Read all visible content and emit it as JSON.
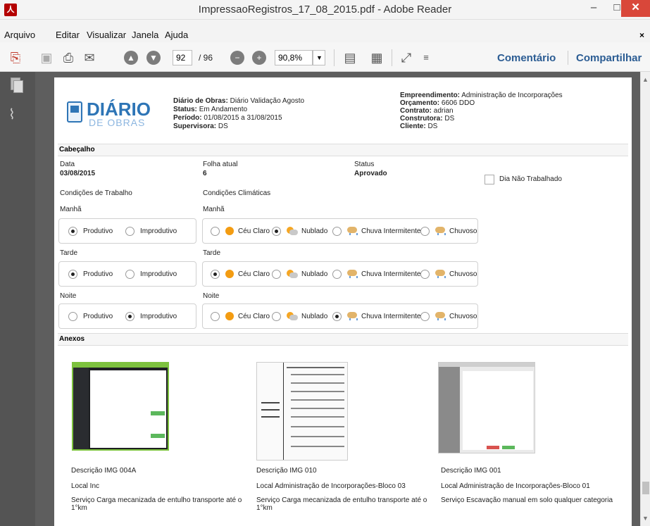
{
  "window": {
    "title": "ImpressaoRegistros_17_08_2015.pdf - Adobe Reader",
    "minimize": "–",
    "maximize": "□",
    "close": "✕"
  },
  "menu": [
    "Arquivo",
    "Editar",
    "Visualizar",
    "Janela",
    "Ajuda"
  ],
  "menu_close": "×",
  "toolbar": {
    "page_current": "92",
    "page_total": "/ 96",
    "zoom": "90,8%",
    "comment_label": "Comentário",
    "share_label": "Compartilhar"
  },
  "document": {
    "logo": {
      "title": "DIÁRIO",
      "subtitle": "DE OBRAS"
    },
    "header_left": [
      {
        "label": "Diário de Obras:",
        "value": "Diário Validação Agosto"
      },
      {
        "label": "Status:",
        "value": "Em Andamento"
      },
      {
        "label": "Período:",
        "value": "01/08/2015 a 31/08/2015"
      },
      {
        "label": "Supervisora:",
        "value": "DS"
      }
    ],
    "header_right": [
      {
        "label": "Empreendimento:",
        "value": "Administração de Incorporações"
      },
      {
        "label": "Orçamento:",
        "value": "6606 DDO"
      },
      {
        "label": "Contrato:",
        "value": "adrian"
      },
      {
        "label": "Construtora:",
        "value": "DS"
      },
      {
        "label": "Cliente:",
        "value": "DS"
      }
    ],
    "section_cabecalho": "Cabeçalho",
    "data_label": "Data",
    "data_value": "03/08/2015",
    "folha_label": "Folha atual",
    "folha_value": "6",
    "status_label": "Status",
    "status_value": "Aprovado",
    "nao_trabalhado": "Dia Não Trabalhado",
    "cond_trabalho": "Condições de Trabalho",
    "cond_climaticas": "Condições Climáticas",
    "periods": [
      {
        "name": "Manhã",
        "work_selected": "Produtivo",
        "weather_selected": "Nublado"
      },
      {
        "name": "Tarde",
        "work_selected": "Produtivo",
        "weather_selected": "Céu Claro"
      },
      {
        "name": "Noite",
        "work_selected": "Improdutivo",
        "weather_selected": "Chuva Intermitente"
      }
    ],
    "work_options": [
      "Produtivo",
      "Improdutivo"
    ],
    "weather_options": [
      "Céu Claro",
      "Nublado",
      "Chuva Intermitente",
      "Chuvoso"
    ],
    "section_anexos": "Anexos",
    "anexos": [
      {
        "descricao": "Descrição IMG 004A",
        "local": "Local Inc",
        "servico": "Serviço Carga mecanizada de entulho transporte até o",
        "servico2": "1°km"
      },
      {
        "descricao": "Descrição IMG 010",
        "local": "Local Administração de Incorporações-Bloco 03",
        "servico": "Serviço Carga mecanizada de entulho transporte até o",
        "servico2": "1°km"
      },
      {
        "descricao": "Descrição IMG 001",
        "local": "Local Administração de Incorporações-Bloco 01",
        "servico": "Serviço Escavação manual em solo qualquer categoria",
        "servico2": ""
      }
    ]
  }
}
